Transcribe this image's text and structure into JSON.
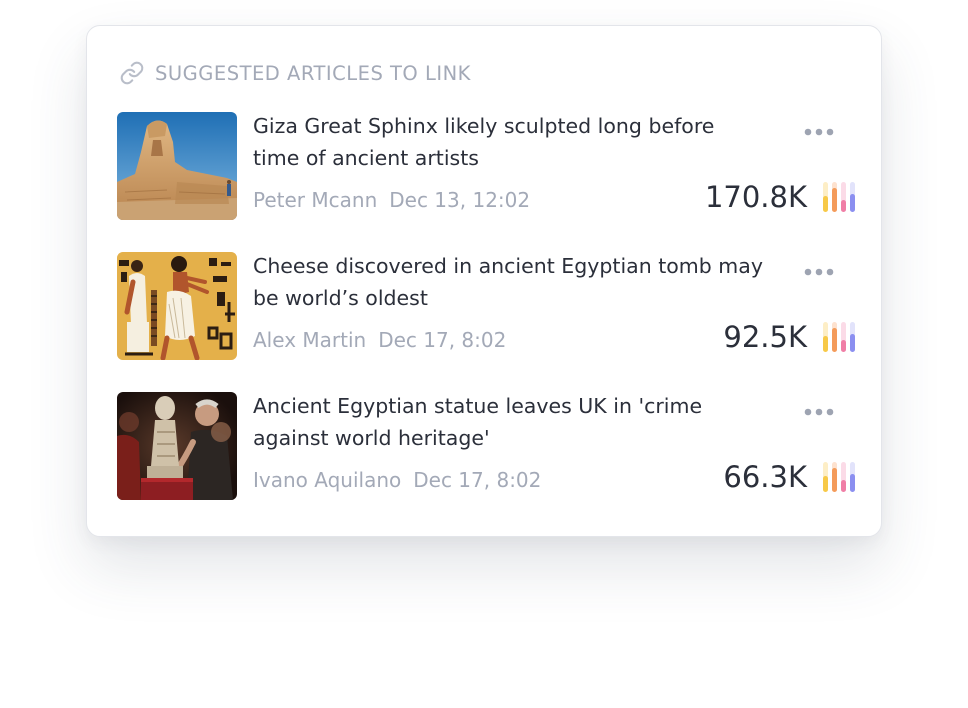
{
  "panel": {
    "title": "SUGGESTED ARTICLES TO LINK",
    "header_icon": "link-icon"
  },
  "colors": {
    "headline": "#2b2f3a",
    "muted": "#a3a9b7",
    "bar_yellow": "#f7c948",
    "bar_orange": "#f49b5a",
    "bar_pink": "#f07ea6",
    "bar_blue": "#8b8ff0"
  },
  "articles": [
    {
      "headline": "Giza Great Sphinx likely sculpted long before time of ancient artists",
      "author": "Peter Mcann",
      "date": "Dec 13, 12:02",
      "views": "170.8K",
      "thumbnail": "sphinx-photo",
      "more_icon": "more-horizontal-icon",
      "stats_icon": "bar-chart-icon"
    },
    {
      "headline": "Cheese discovered in ancient Egyptian tomb may be world’s oldest",
      "author": "Alex Martin",
      "date": "Dec 17, 8:02",
      "views": "92.5K",
      "thumbnail": "egyptian-mural-photo",
      "more_icon": "more-horizontal-icon",
      "stats_icon": "bar-chart-icon"
    },
    {
      "headline": "Ancient Egyptian statue leaves UK in 'crime against world heritage'",
      "author": "Ivano Aquilano",
      "date": "Dec 17, 8:02",
      "views": "66.3K",
      "thumbnail": "statue-photo",
      "more_icon": "more-horizontal-icon",
      "stats_icon": "bar-chart-icon"
    }
  ]
}
